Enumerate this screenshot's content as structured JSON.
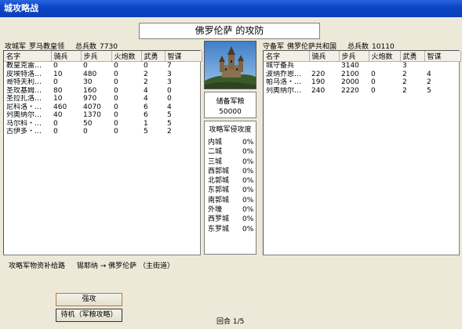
{
  "window": {
    "title": "城攻略战"
  },
  "banner": {
    "title": "佛罗伦萨 的攻防"
  },
  "attacker": {
    "side_label": "攻城军",
    "leader": "罗马教皇领",
    "total_label": "总兵数",
    "total": "7730",
    "columns": [
      "名字",
      "骑兵",
      "步兵",
      "火炮数",
      "武勇",
      "智谋"
    ],
    "rows": [
      [
        "教皇克雷…",
        "0",
        "0",
        "0",
        "0",
        "7"
      ],
      [
        "皮埃特洛…",
        "10",
        "480",
        "0",
        "2",
        "3"
      ],
      [
        "哥特夫利…",
        "0",
        "30",
        "0",
        "2",
        "3"
      ],
      [
        "圣玫基姆…",
        "80",
        "160",
        "0",
        "4",
        "0"
      ],
      [
        "圣拉扎洛…",
        "10",
        "970",
        "0",
        "4",
        "0"
      ],
      [
        "尼科洛・…",
        "460",
        "4070",
        "0",
        "6",
        "4"
      ],
      [
        "列奥纳尔…",
        "40",
        "1370",
        "0",
        "6",
        "5"
      ],
      [
        "马尔科・…",
        "0",
        "50",
        "0",
        "1",
        "5"
      ],
      [
        "古伊多・…",
        "0",
        "0",
        "0",
        "5",
        "2"
      ]
    ]
  },
  "defender": {
    "side_label": "守备军",
    "leader": "佛罗伦萨共和国",
    "total_label": "总兵数",
    "total": "10110",
    "columns": [
      "名字",
      "骑兵",
      "步兵",
      "火炮数",
      "武勇",
      "智谋"
    ],
    "rows": [
      [
        "城守备兵",
        "",
        "3140",
        "",
        "3",
        ""
      ],
      [
        "波纳乔恩…",
        "220",
        "2100",
        "0",
        "2",
        "4"
      ],
      [
        "帕乌洛・…",
        "190",
        "2000",
        "0",
        "2",
        "2"
      ],
      [
        "列奥纳尔…",
        "240",
        "2220",
        "0",
        "2",
        "5"
      ]
    ]
  },
  "reserve": {
    "label": "储备军粮",
    "value": "50000"
  },
  "invasion": {
    "label": "攻略军侵攻度",
    "items": [
      {
        "name": "内城",
        "pct": "0%"
      },
      {
        "name": "二城",
        "pct": "0%"
      },
      {
        "name": "三城",
        "pct": "0%"
      },
      {
        "name": "西郭城",
        "pct": "0%"
      },
      {
        "name": "北郭城",
        "pct": "0%"
      },
      {
        "name": "东郭城",
        "pct": "0%"
      },
      {
        "name": "南郭城",
        "pct": "0%"
      },
      {
        "name": "外壕",
        "pct": "0%"
      },
      {
        "name": "西罗城",
        "pct": "0%"
      },
      {
        "name": "东罗城",
        "pct": "0%"
      }
    ]
  },
  "supply": {
    "label": "攻略军物资补给路",
    "route": "锡耶纳 → 佛罗伦萨 （主街道）"
  },
  "buttons": {
    "attack": "强攻",
    "wait": "待机（军粮攻略）"
  },
  "round": {
    "label": "回合",
    "value": "1/5"
  }
}
